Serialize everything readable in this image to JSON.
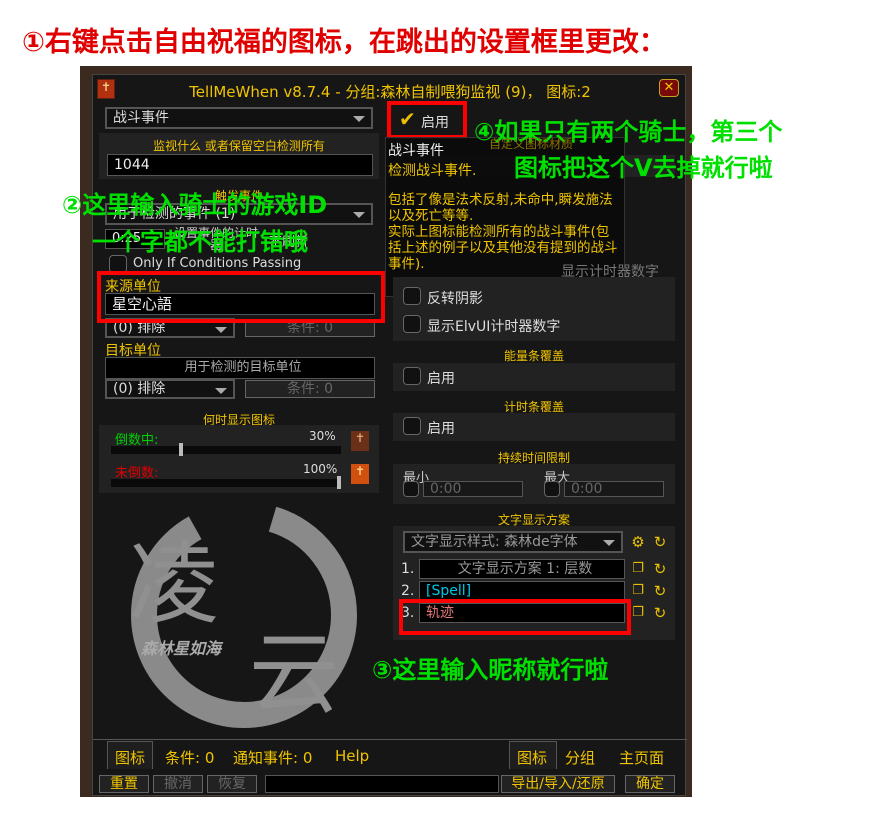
{
  "annotations": {
    "step1": "①右键点击自由祝福的图标，在跳出的设置框里更改：",
    "step2_line1": "②这里输入骑士的游戏ID",
    "step2_line2": "一个字都不能打错哦",
    "step3": "③这里输入昵称就行啦",
    "step4_line1": "④如果只有两个骑士，第三个",
    "step4_line2": "图标把这个V去掉就行啦"
  },
  "window": {
    "title": "TellMeWhen v8.7.4  - 分组:森林自制喂狗监视 (9)， 图标:2",
    "close": "✕"
  },
  "left": {
    "type_dropdown": "战斗事件",
    "what_label": "监视什么 或者保留空白检测所有",
    "what_value": "1044",
    "events_label": "触发事件",
    "events_dropdown": "用于检测的事件 (1)",
    "timer_value": "0:25",
    "timer_label": "设置事件的计时器",
    "no_refresh": "不刷新",
    "only_if_conditions": "Only If Conditions Passing",
    "source_label": "来源单位",
    "source_value": "星空心語",
    "source_exclude": "(0) 排除",
    "source_conditions": "条件: 0",
    "dest_label": "目标单位",
    "dest_placeholder": "用于检测的目标单位",
    "dest_exclude": "(0) 排除",
    "dest_conditions": "条件: 0",
    "when_label": "何时显示图标",
    "counting_label": "倒数中:",
    "counting_value": "30%",
    "counting_percent": 30,
    "not_counting_label": "未倒数:",
    "not_counting_value": "100%",
    "not_counting_percent": 100,
    "watermark_text": "森林星如海"
  },
  "right": {
    "enabled_label": "启用",
    "enabled_checked": true,
    "custom_texture_label": "自定义图标材质",
    "tooltip_title": "战斗事件",
    "tooltip_subtitle": "检测战斗事件.",
    "tooltip_body": "包括了像是法术反射,未命中,瞬发施法以及死亡等等.\n实际上图标能检测所有的战斗事件(包括上述的例子以及其他没有提到的战斗事件).",
    "show_timer_number": "显示计时器数字",
    "invert_shadow": "反转阴影",
    "elvui_timer": "显示ElvUI计时器数字",
    "power_bar_label": "能量条覆盖",
    "power_bar_enable": "启用",
    "timer_bar_label": "计时条覆盖",
    "timer_bar_enable": "启用",
    "duration_label": "持续时间限制",
    "min_label": "最小",
    "min_value": "0:00",
    "max_label": "最大",
    "max_value": "0:00",
    "text_layout_label": "文字显示方案",
    "text_style_dropdown": "文字显示样式: 森林de字体",
    "text_rows": [
      {
        "num": "1.",
        "value": "文字显示方案 1: 层数"
      },
      {
        "num": "2.",
        "value": "[Spell]"
      },
      {
        "num": "3.",
        "value": "轨迹"
      }
    ]
  },
  "bottom_tabs": {
    "icon": "图标",
    "conditions": "条件: 0",
    "notifications": "通知事件: 0",
    "help": "Help"
  },
  "right_tabs": {
    "icon": "图标",
    "group": "分组",
    "main": "主页面"
  },
  "footer": {
    "reset": "重置",
    "undo": "撤消",
    "redo": "恢复",
    "export": "导出/导入/还原",
    "ok": "确定"
  },
  "colors": {
    "gold": "#f0c400",
    "annotation_green": "#00e000",
    "annotation_red": "#e00000",
    "highlight_box": "#ff0000",
    "counting": "#00d000",
    "not_counting": "#e00000",
    "spell_cyan": "#00c8e8",
    "nickname_pink": "#e87878"
  }
}
